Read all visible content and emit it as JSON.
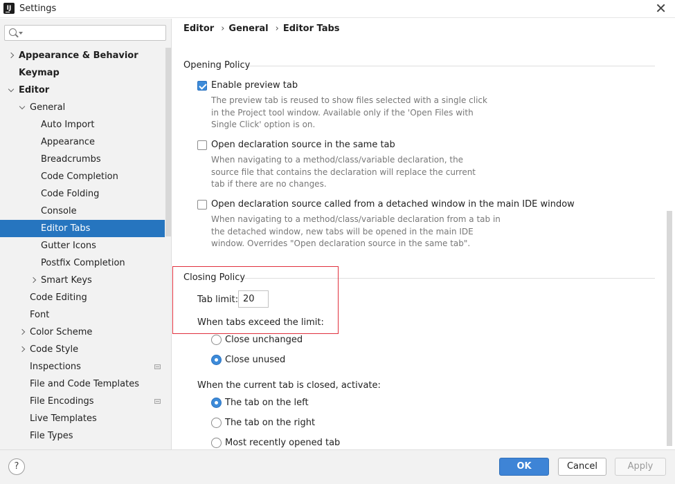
{
  "window": {
    "title": "Settings",
    "app_icon_text": "IJ",
    "close_icon": "close-icon"
  },
  "search": {
    "placeholder": ""
  },
  "sidebar": {
    "items": [
      {
        "label": "Appearance & Behavior",
        "bold": true,
        "level": 0,
        "expander": "right"
      },
      {
        "label": "Keymap",
        "bold": true,
        "level": 0,
        "expander": ""
      },
      {
        "label": "Editor",
        "bold": true,
        "level": 0,
        "expander": "down"
      },
      {
        "label": "General",
        "bold": false,
        "level": 1,
        "expander": "down"
      },
      {
        "label": "Auto Import",
        "bold": false,
        "level": 2,
        "expander": ""
      },
      {
        "label": "Appearance",
        "bold": false,
        "level": 2,
        "expander": ""
      },
      {
        "label": "Breadcrumbs",
        "bold": false,
        "level": 2,
        "expander": ""
      },
      {
        "label": "Code Completion",
        "bold": false,
        "level": 2,
        "expander": ""
      },
      {
        "label": "Code Folding",
        "bold": false,
        "level": 2,
        "expander": ""
      },
      {
        "label": "Console",
        "bold": false,
        "level": 2,
        "expander": ""
      },
      {
        "label": "Editor Tabs",
        "bold": false,
        "level": 2,
        "expander": "",
        "selected": true
      },
      {
        "label": "Gutter Icons",
        "bold": false,
        "level": 2,
        "expander": ""
      },
      {
        "label": "Postfix Completion",
        "bold": false,
        "level": 2,
        "expander": ""
      },
      {
        "label": "Smart Keys",
        "bold": false,
        "level": 2,
        "expander": "right"
      },
      {
        "label": "Code Editing",
        "bold": false,
        "level": 1,
        "expander": ""
      },
      {
        "label": "Font",
        "bold": false,
        "level": 1,
        "expander": ""
      },
      {
        "label": "Color Scheme",
        "bold": false,
        "level": 1,
        "expander": "right"
      },
      {
        "label": "Code Style",
        "bold": false,
        "level": 1,
        "expander": "right"
      },
      {
        "label": "Inspections",
        "bold": false,
        "level": 1,
        "expander": "",
        "badge": true
      },
      {
        "label": "File and Code Templates",
        "bold": false,
        "level": 1,
        "expander": ""
      },
      {
        "label": "File Encodings",
        "bold": false,
        "level": 1,
        "expander": "",
        "badge": true
      },
      {
        "label": "Live Templates",
        "bold": false,
        "level": 1,
        "expander": ""
      },
      {
        "label": "File Types",
        "bold": false,
        "level": 1,
        "expander": ""
      }
    ]
  },
  "breadcrumb": {
    "items": [
      "Editor",
      "General",
      "Editor Tabs"
    ],
    "separator": "›"
  },
  "opening_policy": {
    "title": "Opening Policy",
    "options": [
      {
        "label": "Enable preview tab",
        "checked": true,
        "hint": "The preview tab is reused to show files selected with a single click in the Project tool window. Available only if the 'Open Files with Single Click' option is on."
      },
      {
        "label": "Open declaration source in the same tab",
        "checked": false,
        "hint": "When navigating to a method/class/variable declaration, the source file that contains the declaration will replace the current tab if there are no changes."
      },
      {
        "label": "Open declaration source called from a detached window in the main IDE window",
        "checked": false,
        "hint": "When navigating to a method/class/variable declaration from a tab in the detached window, new tabs will be opened in the main IDE window. Overrides \"Open declaration source in the same tab\"."
      }
    ]
  },
  "closing_policy": {
    "title": "Closing Policy",
    "tab_limit_label": "Tab limit:",
    "tab_limit_value": "20",
    "exceed_label": "When tabs exceed the limit:",
    "exceed_options": [
      {
        "label": "Close unchanged",
        "checked": false
      },
      {
        "label": "Close unused",
        "checked": true
      }
    ],
    "activate_label": "When the current tab is closed, activate:",
    "activate_options": [
      {
        "label": "The tab on the left",
        "checked": true
      },
      {
        "label": "The tab on the right",
        "checked": false
      },
      {
        "label": "Most recently opened tab",
        "checked": false
      }
    ]
  },
  "footer": {
    "help_label": "?",
    "ok_label": "OK",
    "cancel_label": "Cancel",
    "apply_label": "Apply"
  },
  "colors": {
    "selection": "#2675bf",
    "primary_button": "#3e84d6",
    "highlight_box": "#e02f3c",
    "checkbox_checked": "#3d8bd9"
  }
}
